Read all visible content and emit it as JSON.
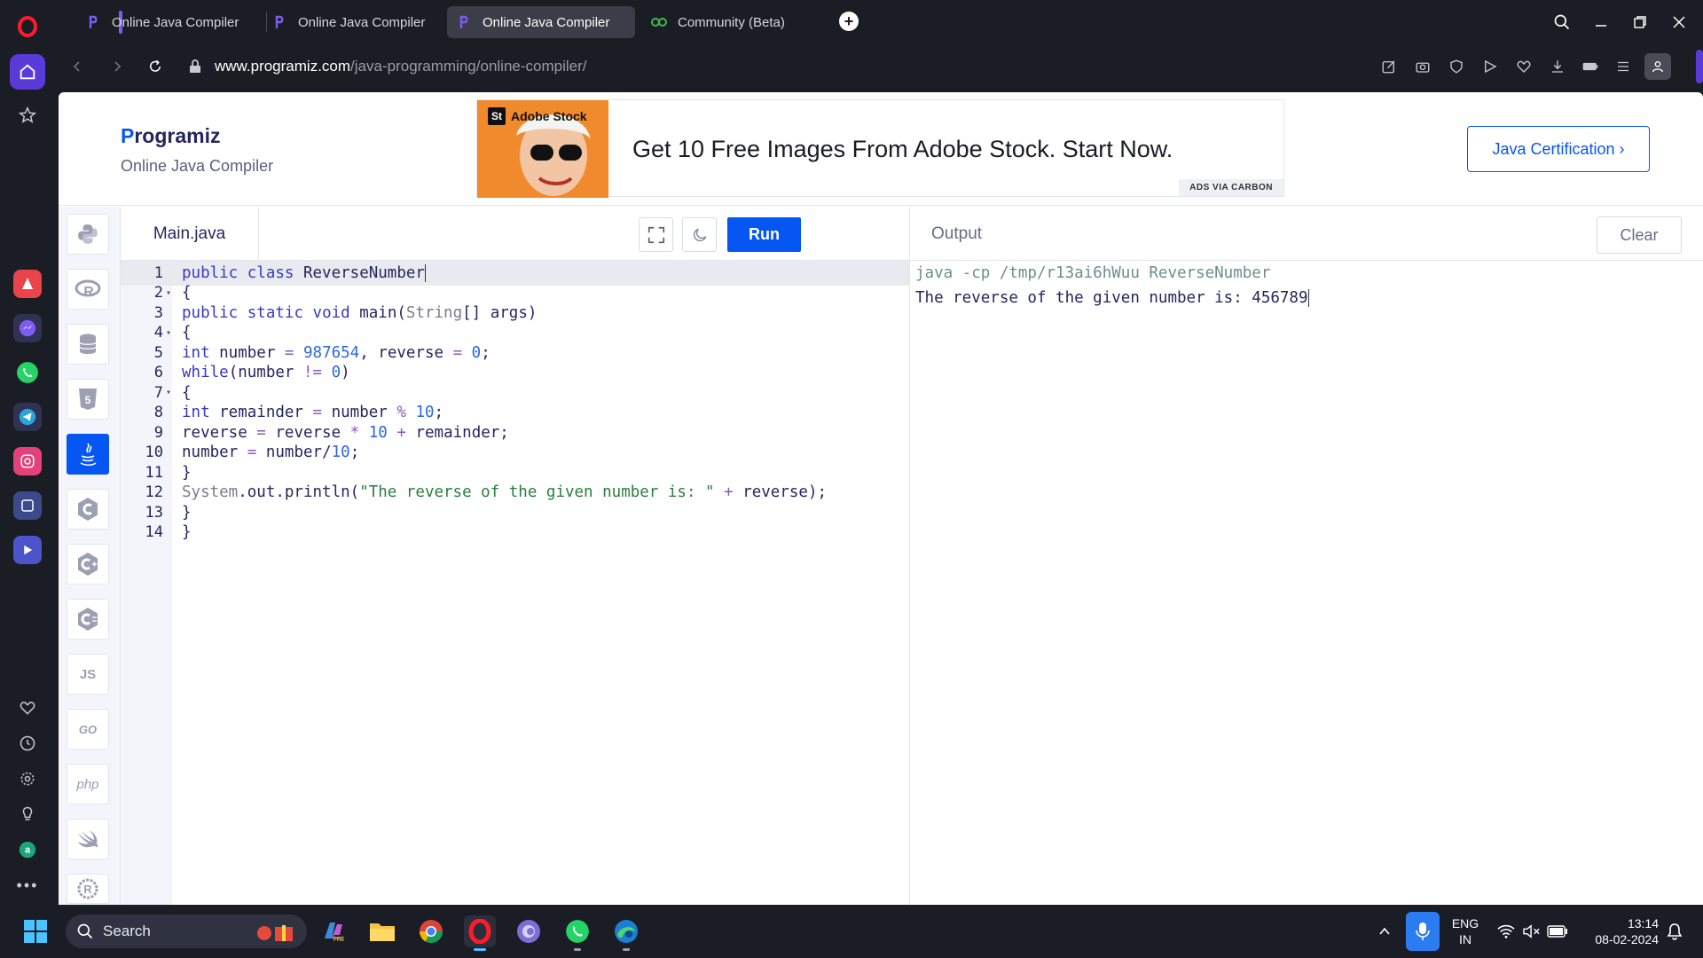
{
  "browser": {
    "tabs": [
      {
        "label": "Online Java Compiler",
        "active": false
      },
      {
        "label": "Online Java Compiler",
        "active": false
      },
      {
        "label": "Online Java Compiler",
        "active": true
      },
      {
        "label": "Community (Beta)",
        "active": false
      }
    ],
    "url_host": "www.programiz.com",
    "url_path": "/java-programming/online-compiler/"
  },
  "site": {
    "logo_p": "P",
    "logo_rest": "rogramiz",
    "subtitle": "Online Java Compiler",
    "ad_brand": "Adobe Stock",
    "ad_brand_icon": "St",
    "ad_text": "Get 10 Free Images From Adobe Stock. Start Now.",
    "ad_carbon": "ADS VIA CARBON",
    "cert_button": "Java Certification ›"
  },
  "languages": [
    "python",
    "r",
    "sql",
    "html",
    "java",
    "c",
    "cpp",
    "csharp",
    "JS",
    "GO",
    "php",
    "swift",
    "rust"
  ],
  "editor": {
    "file_name": "Main.java",
    "run_label": "Run",
    "lines": [
      "1",
      "2",
      "3",
      "4",
      "5",
      "6",
      "7",
      "8",
      "9",
      "10",
      "11",
      "12",
      "13",
      "14"
    ]
  },
  "output": {
    "title": "Output",
    "clear_label": "Clear",
    "command": "java -cp /tmp/r13ai6hWuu ReverseNumber",
    "result": "The reverse of the given number is: 456789"
  },
  "taskbar": {
    "search_label": "Search",
    "lang_top": "ENG",
    "lang_bottom": "IN",
    "time": "13:14",
    "date": "08-02-2024"
  },
  "colors": {
    "accent": "#0556f3",
    "opera_purple": "#5a3bd9",
    "page_text": "#25265e"
  }
}
